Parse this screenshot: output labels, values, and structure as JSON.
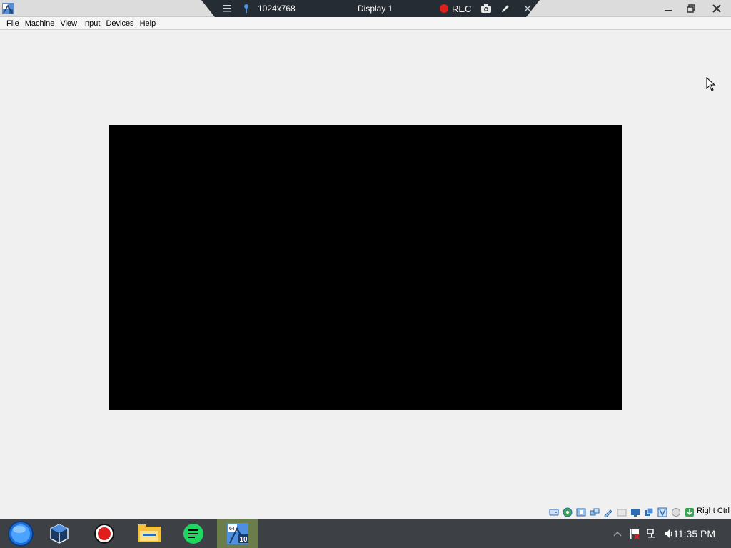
{
  "titlebar": {
    "app_icon": "virtualbox-app-icon",
    "controls": [
      "minimize-icon",
      "restore-icon",
      "close-icon"
    ]
  },
  "minitoolbar": {
    "resolution": "1024x768",
    "display_name": "Display 1",
    "rec_label": "REC",
    "rec_color": "#e01e1e"
  },
  "menubar": {
    "items": [
      "File",
      "Machine",
      "View",
      "Input",
      "Devices",
      "Help"
    ]
  },
  "statusbar": {
    "icons": [
      "hard-disk-icon",
      "optical-drive-icon",
      "audio-icon",
      "network-icon",
      "usb-icon",
      "shared-folders-icon",
      "display-icon",
      "video-capture-icon",
      "recording-icon",
      "virtualization-icon",
      "mouse-integration-icon",
      "keyboard-icon"
    ],
    "host_key": "Right Ctrl"
  },
  "taskbar": {
    "buttons": [
      "start-orb-icon",
      "virtualbox-icon",
      "record-icon",
      "file-explorer-icon",
      "notes-icon",
      "windows10-vm-icon"
    ],
    "active_index": 5,
    "tray_icons": [
      "show-hidden-icons-chevron",
      "action-center-flag-icon",
      "network-icon",
      "volume-icon"
    ],
    "clock": "11:35 PM"
  }
}
